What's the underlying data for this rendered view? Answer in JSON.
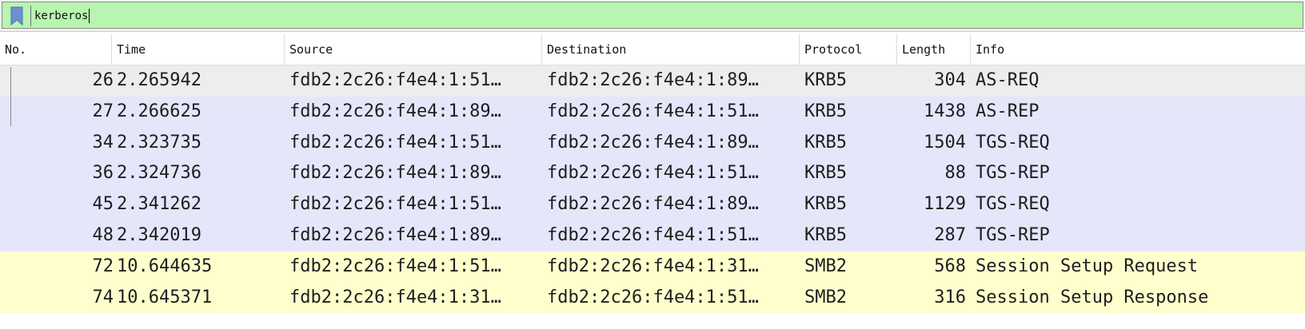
{
  "filter": {
    "value": "kerberos",
    "bookmark_icon": "bookmark-icon"
  },
  "columns": [
    "No.",
    "Time",
    "Source",
    "Destination",
    "Protocol",
    "Length",
    "Info"
  ],
  "packets": [
    {
      "no": "26",
      "time": "2.265942",
      "source": "fdb2:2c26:f4e4:1:51…",
      "destination": "fdb2:2c26:f4e4:1:89…",
      "protocol": "KRB5",
      "length": "304",
      "info": "AS-REQ"
    },
    {
      "no": "27",
      "time": "2.266625",
      "source": "fdb2:2c26:f4e4:1:89…",
      "destination": "fdb2:2c26:f4e4:1:51…",
      "protocol": "KRB5",
      "length": "1438",
      "info": "AS-REP"
    },
    {
      "no": "34",
      "time": "2.323735",
      "source": "fdb2:2c26:f4e4:1:51…",
      "destination": "fdb2:2c26:f4e4:1:89…",
      "protocol": "KRB5",
      "length": "1504",
      "info": "TGS-REQ"
    },
    {
      "no": "36",
      "time": "2.324736",
      "source": "fdb2:2c26:f4e4:1:89…",
      "destination": "fdb2:2c26:f4e4:1:51…",
      "protocol": "KRB5",
      "length": "88",
      "info": "TGS-REP"
    },
    {
      "no": "45",
      "time": "2.341262",
      "source": "fdb2:2c26:f4e4:1:51…",
      "destination": "fdb2:2c26:f4e4:1:89…",
      "protocol": "KRB5",
      "length": "1129",
      "info": "TGS-REQ"
    },
    {
      "no": "48",
      "time": "2.342019",
      "source": "fdb2:2c26:f4e4:1:89…",
      "destination": "fdb2:2c26:f4e4:1:51…",
      "protocol": "KRB5",
      "length": "287",
      "info": "TGS-REP"
    },
    {
      "no": "72",
      "time": "10.644635",
      "source": "fdb2:2c26:f4e4:1:51…",
      "destination": "fdb2:2c26:f4e4:1:31…",
      "protocol": "SMB2",
      "length": "568",
      "info": "Session Setup Request"
    },
    {
      "no": "74",
      "time": "10.645371",
      "source": "fdb2:2c26:f4e4:1:31…",
      "destination": "fdb2:2c26:f4e4:1:51…",
      "protocol": "SMB2",
      "length": "316",
      "info": "Session Setup Response"
    }
  ],
  "colors": {
    "filter_valid_bg": "#b8f5b0",
    "kerberos_row_bg": "#e6e6fb",
    "smb_row_bg": "#ffffcd",
    "selected_row_bg": "#ededed"
  }
}
